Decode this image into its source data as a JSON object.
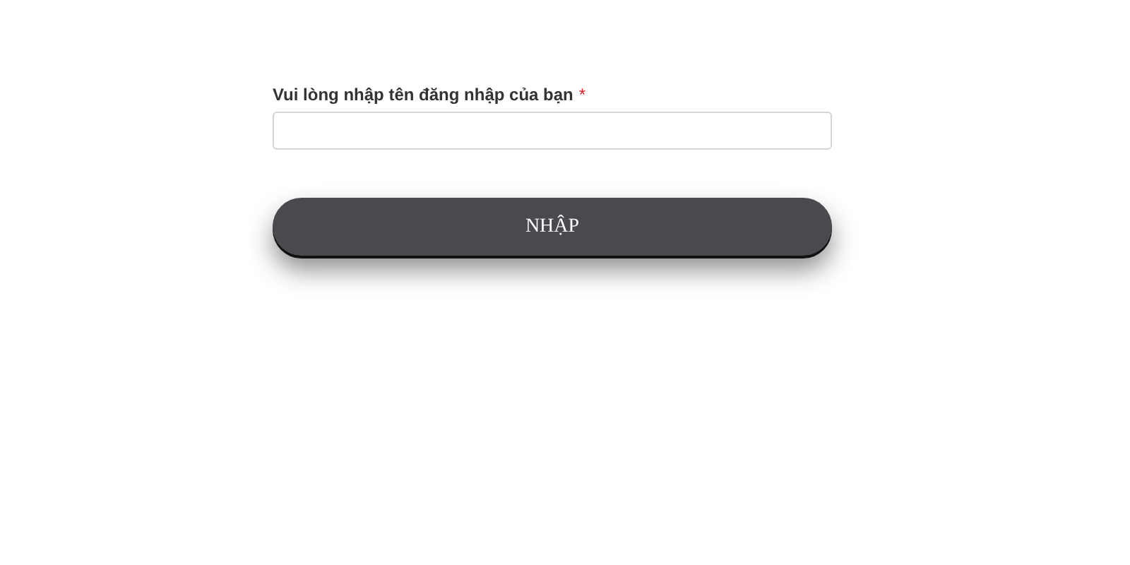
{
  "field": {
    "label": "Vui lòng nhập tên đăng nhập của bạn",
    "required_mark": "*"
  },
  "button": {
    "label": "NHẬP"
  }
}
